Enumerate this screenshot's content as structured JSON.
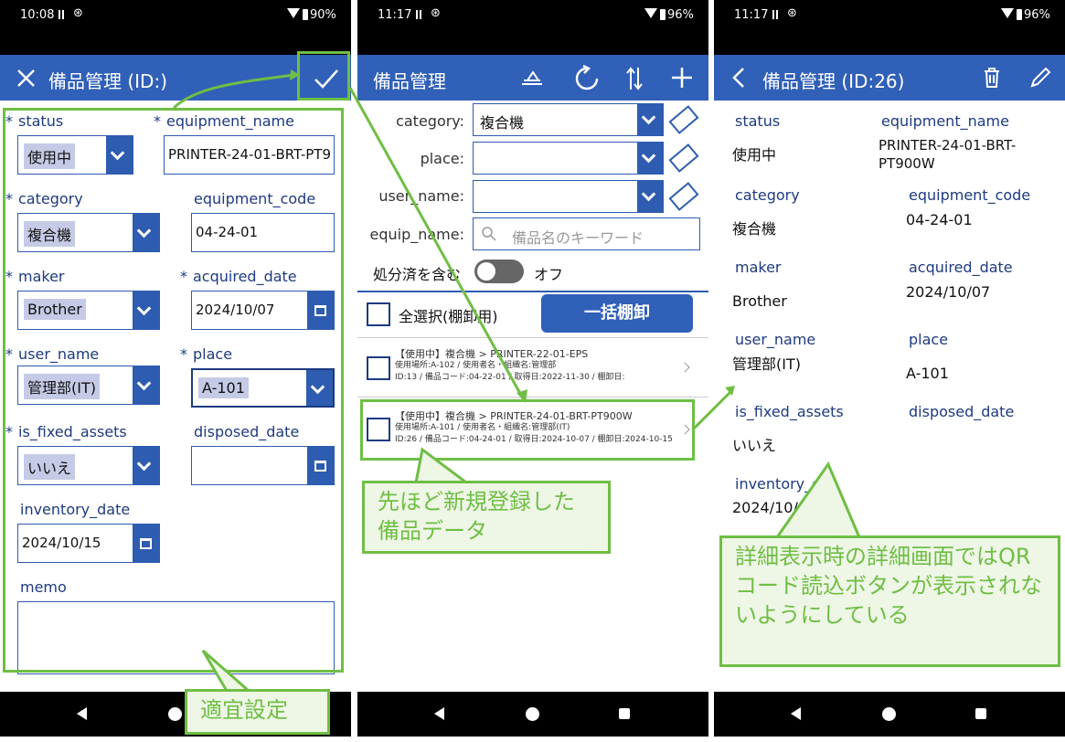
{
  "screen1": {
    "status_bar": {
      "time": "10:08",
      "battery": "90%"
    },
    "appbar_title": "備品管理 (ID:)",
    "fields": {
      "status": {
        "label": "status",
        "value": "使用中"
      },
      "equipment_name": {
        "label": "equipment_name",
        "value": "PRINTER-24-01-BRT-PT9"
      },
      "category": {
        "label": "category",
        "value": "複合機"
      },
      "equipment_code": {
        "label": "equipment_code",
        "value": "04-24-01"
      },
      "maker": {
        "label": "maker",
        "value": "Brother"
      },
      "acquired_date": {
        "label": "acquired_date",
        "value": "2024/10/07"
      },
      "user_name": {
        "label": "user_name",
        "value": "管理部(IT)"
      },
      "place": {
        "label": "place",
        "value": "A-101"
      },
      "is_fixed_assets": {
        "label": "is_fixed_assets",
        "value": "いいえ"
      },
      "disposed_date": {
        "label": "disposed_date",
        "value": ""
      },
      "inventory_date": {
        "label": "inventory_date",
        "value": "2024/10/15"
      },
      "memo": {
        "label": "memo",
        "value": ""
      }
    },
    "required_mark": "*",
    "callout": "適宜設定"
  },
  "screen2": {
    "status_bar": {
      "time": "11:17",
      "battery": "96%"
    },
    "appbar_title": "備品管理",
    "filters": {
      "category": {
        "label": "category:",
        "value": "複合機"
      },
      "place": {
        "label": "place:",
        "value": ""
      },
      "user_name": {
        "label": "user_name:",
        "value": ""
      },
      "equip_name": {
        "label": "equip_name:",
        "placeholder": "備品名のキーワード"
      }
    },
    "toggle": {
      "label": "処分済を含む",
      "state": "オフ"
    },
    "select_all_label": "全選択(棚卸用)",
    "bulk_button": "一括棚卸",
    "list": [
      {
        "title": "【使用中】複合機 > PRINTER-22-01-EPS",
        "line2": "使用場所:A-102 / 使用者名・組織名:管理部",
        "line3": "ID:13 / 備品コード:04-22-01 / 取得日:2022-11-30 / 棚卸日:"
      },
      {
        "title": "【使用中】複合機 > PRINTER-24-01-BRT-PT900W",
        "line2": "使用場所:A-101 / 使用者名・組織名:管理部(IT)",
        "line3": "ID:26 / 備品コード:04-24-01 / 取得日:2024-10-07 / 棚卸日:2024-10-15"
      }
    ],
    "callout": "先ほど新規登録した備品データ"
  },
  "screen3": {
    "status_bar": {
      "time": "11:17",
      "battery": "96%"
    },
    "appbar_title": "備品管理 (ID:26)",
    "details": {
      "status": {
        "label": "status",
        "value": "使用中"
      },
      "equipment_name": {
        "label": "equipment_name",
        "value": "PRINTER-24-01-BRT-PT900W"
      },
      "category": {
        "label": "category",
        "value": "複合機"
      },
      "equipment_code": {
        "label": "equipment_code",
        "value": "04-24-01"
      },
      "maker": {
        "label": "maker",
        "value": "Brother"
      },
      "acquired_date": {
        "label": "acquired_date",
        "value": "2024/10/07"
      },
      "user_name": {
        "label": "user_name",
        "value": "管理部(IT)"
      },
      "place": {
        "label": "place",
        "value": "A-101"
      },
      "is_fixed_assets": {
        "label": "is_fixed_assets",
        "value": "いいえ"
      },
      "disposed_date": {
        "label": "disposed_date",
        "value": ""
      },
      "inventory_date": {
        "label": "inventory_d",
        "value": "2024/10/"
      }
    },
    "callout": "詳細表示時の詳細画面ではQRコード読込ボタンが表示されないようにしている"
  },
  "icons": [
    "close-icon",
    "check-icon",
    "sort-icon",
    "refresh-icon",
    "swap-icon",
    "add-icon",
    "back-icon",
    "trash-icon",
    "edit-icon",
    "chevron-down-icon",
    "calendar-icon",
    "eraser-icon",
    "search-icon"
  ],
  "colors": {
    "appbar": "#3060b8",
    "accent": "#2d5cb0",
    "label": "#1e3a80",
    "annotation": "#6fbe44"
  }
}
